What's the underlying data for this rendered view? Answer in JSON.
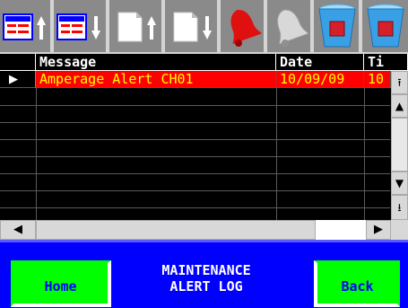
{
  "toolbar": {
    "buttons": [
      {
        "name": "scroll-first-page-button",
        "icon": "table-up-icon"
      },
      {
        "name": "scroll-last-page-button",
        "icon": "table-down-icon"
      },
      {
        "name": "page-up-button",
        "icon": "page-up-icon"
      },
      {
        "name": "page-down-button",
        "icon": "page-down-icon"
      },
      {
        "name": "acknowledge-alert-button",
        "icon": "red-bell-icon"
      },
      {
        "name": "silence-alert-button",
        "icon": "gray-bell-icon"
      },
      {
        "name": "clear-selected-button",
        "icon": "trash-can-icon"
      },
      {
        "name": "clear-all-button",
        "icon": "trash-can-icon"
      }
    ]
  },
  "grid": {
    "columns": [
      "Message",
      "Date",
      "Ti"
    ],
    "rows": [
      {
        "message": "Amperage Alert CH01",
        "date": "10/09/09",
        "time": "10",
        "selected": true
      }
    ],
    "empty_row_count": 9
  },
  "scroll": {
    "top_glyph": "⭱",
    "up_glyph": "▲",
    "down_glyph": "▼",
    "bottom_glyph": "⭳",
    "left_glyph": "◀",
    "right_glyph": "▶"
  },
  "row_indicator": "▶",
  "bottom": {
    "home_label": "Home",
    "title_line1": "MAINTENANCE",
    "title_line2": "ALERT LOG",
    "back_label": "Back"
  },
  "colors": {
    "alert_bg": "#ff0000",
    "alert_text": "#ffff00",
    "nav_button": "#00ff00",
    "bar_bg": "#0000ff"
  }
}
